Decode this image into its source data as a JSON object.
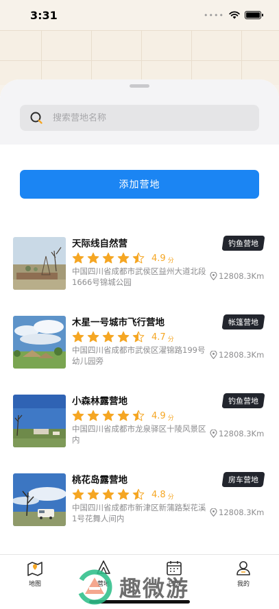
{
  "status_bar": {
    "time": "3:31"
  },
  "search": {
    "placeholder": "搜索营地名称"
  },
  "add_button": {
    "label": "添加营地"
  },
  "camps": [
    {
      "name": "天际线自然营",
      "tag": "钓鱼营地",
      "rating": 4.5,
      "score": "4.9",
      "score_unit": "分",
      "address": "中国四川省成都市武侯区益州大道北段1666号锦城公园",
      "distance": "12808.3Km"
    },
    {
      "name": "木星一号城市飞行营地",
      "tag": "帐篷营地",
      "rating": 4.5,
      "score": "4.7",
      "score_unit": "分",
      "address": "中国四川省成都市武侯区濯锦路199号幼儿园旁",
      "distance": "12808.3Km"
    },
    {
      "name": "小森林露营地",
      "tag": "钓鱼营地",
      "rating": 4.5,
      "score": "4.9",
      "score_unit": "分",
      "address": "中国四川省成都市龙泉驿区十陵风景区内",
      "distance": "12808.3Km"
    },
    {
      "name": "桃花岛露营地",
      "tag": "房车营地",
      "rating": 4.5,
      "score": "4.8",
      "score_unit": "分",
      "address": "中国四川省成都市新津区新蒲路梨花溪1号花舞人间内",
      "distance": "12808.3Km"
    }
  ],
  "tab_bar": {
    "tabs": [
      {
        "label": "地图",
        "icon": "map-icon"
      },
      {
        "label": "营地",
        "icon": "tent-icon"
      },
      {
        "label": "日历",
        "icon": "calendar-icon"
      },
      {
        "label": "我的",
        "icon": "profile-icon"
      }
    ]
  },
  "watermark": {
    "text": "趣微游"
  },
  "colors": {
    "accent": "#1b85f3",
    "star": "#f5a623",
    "tag_bg": "#22252d"
  }
}
